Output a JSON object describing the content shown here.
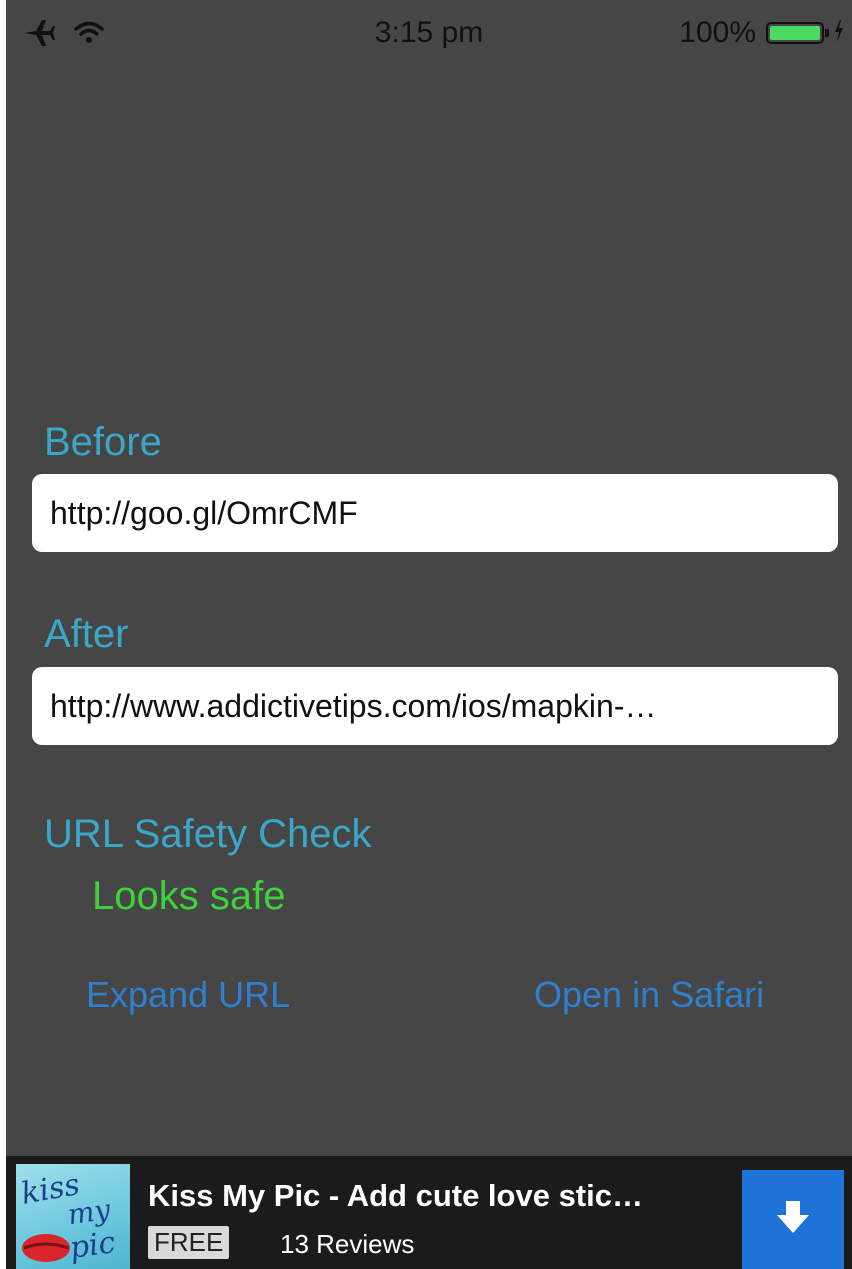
{
  "status_bar": {
    "time": "3:15 pm",
    "battery_percent_label": "100%",
    "battery_level": 1.0,
    "icons": [
      "airplane-icon",
      "wifi-icon",
      "battery-icon",
      "charging-icon"
    ]
  },
  "before": {
    "label": "Before",
    "value": "http://goo.gl/OmrCMF"
  },
  "after": {
    "label": "After",
    "value": "http://www.addictivetips.com/ios/mapkin-…"
  },
  "safety": {
    "label": "URL Safety Check",
    "status": "Looks safe"
  },
  "actions": {
    "expand_label": "Expand URL",
    "open_label": "Open in Safari"
  },
  "ad": {
    "icon_text": "kiss my pic",
    "title": "Kiss My Pic - Add cute love stic…",
    "price": "FREE",
    "reviews": "13 Reviews",
    "download_icon": "download-arrow-icon"
  },
  "colors": {
    "background": "#464646",
    "label": "#3aa7c8",
    "safe": "#3ed23a",
    "link": "#2f7fd0",
    "ad_button": "#1f73d8",
    "battery": "#4cd964"
  }
}
